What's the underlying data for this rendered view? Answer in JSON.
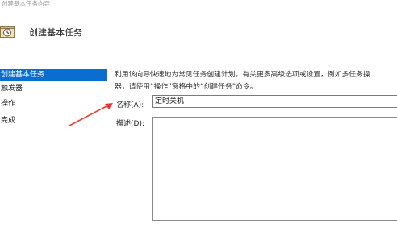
{
  "window": {
    "title": "创建基本任务向导"
  },
  "header": {
    "title": "创建基本任务",
    "icon": "calendar-clock-icon"
  },
  "sidebar": {
    "items": [
      {
        "label": "创建基本任务",
        "active": true
      },
      {
        "label": "触发器",
        "active": false
      },
      {
        "label": "操作",
        "active": false
      },
      {
        "label": "完成",
        "active": false
      }
    ]
  },
  "main": {
    "description_line1": "利用该向导快速地为常见任务创建计划。有关更多高级选项或设置，例如多任务操",
    "description_line2": "器，请使用“操作”窗格中的“创建任务”命令。",
    "name_label": "名称(A):",
    "name_value": "定时关机",
    "description_label": "描述(D):",
    "description_value": ""
  },
  "colors": {
    "accent": "#0a6ed1",
    "arrow": "#e8392c"
  }
}
